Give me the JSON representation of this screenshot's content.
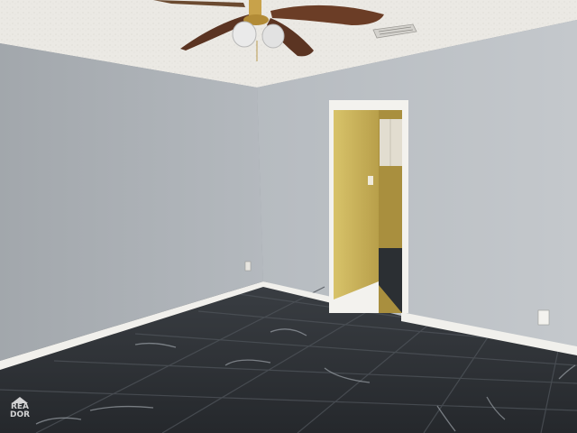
{
  "scene": {
    "description_type": "photo",
    "colors": {
      "ceiling": "#e9e7e2",
      "left_wall": "#a7acb1",
      "right_wall": "#b9bec3",
      "baseboard": "#f1f0ec",
      "doorway_wall": "#d9c46a",
      "floor": "#2f3338",
      "fan_blade": "#5b3422"
    }
  },
  "watermark": {
    "logo_text": "REA DOR"
  }
}
